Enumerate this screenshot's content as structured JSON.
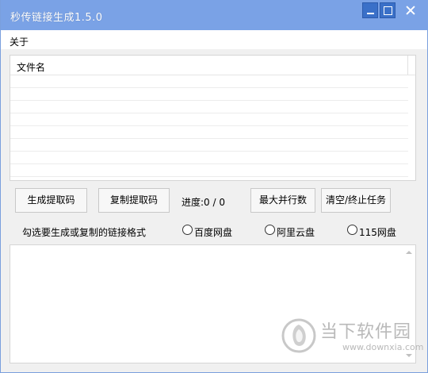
{
  "window": {
    "title": "秒传链接生成1.5.0"
  },
  "menu": {
    "about": "关于"
  },
  "list": {
    "column_header": "文件名",
    "rows": []
  },
  "buttons": {
    "generate": "生成提取码",
    "copy": "复制提取码",
    "max_parallel": "最大并行数",
    "clear_stop": "清空/终止任务"
  },
  "progress": {
    "label": "进度:0 / 0"
  },
  "format": {
    "label": "勾选要生成或复制的链接格式",
    "options": [
      {
        "label": "百度网盘",
        "checked": false
      },
      {
        "label": "阿里云盘",
        "checked": false
      },
      {
        "label": "115网盘",
        "checked": false
      }
    ]
  },
  "output": {
    "text": ""
  },
  "watermark": {
    "brand": "当下软件园",
    "url": "www.downxia.com"
  },
  "colors": {
    "titlebar": "#7aa2e6",
    "window_bg": "#f0f0f0",
    "watermark": "#b9b9b9"
  }
}
